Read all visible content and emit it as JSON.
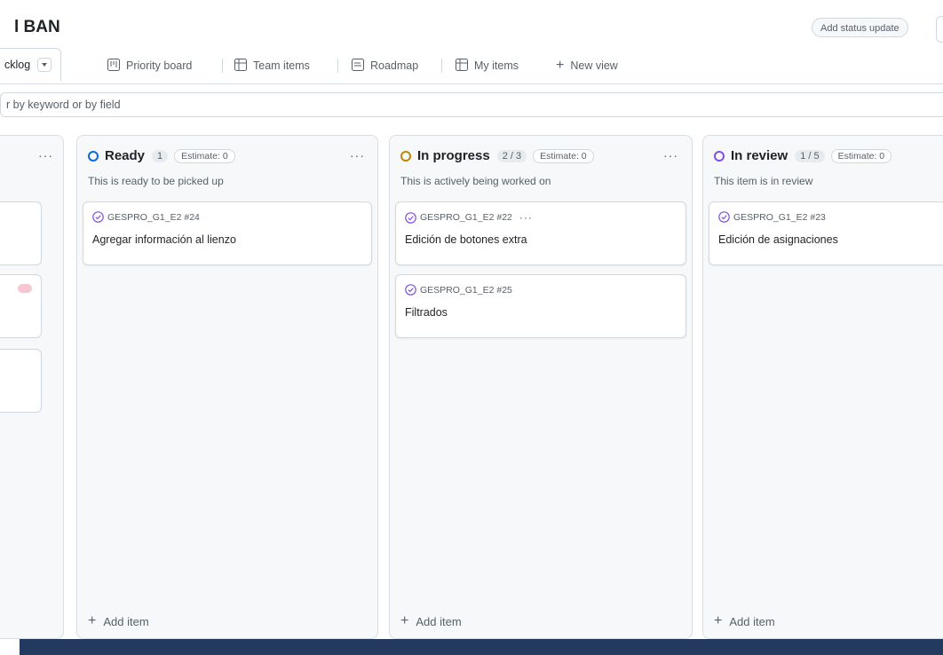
{
  "header": {
    "title": "l BAN",
    "status_button": "Add status update"
  },
  "tabs": [
    {
      "label": "cklog",
      "icon": "dropdown-icon"
    },
    {
      "label": "Priority board",
      "icon": "board-icon"
    },
    {
      "label": "Team items",
      "icon": "table-icon"
    },
    {
      "label": "Roadmap",
      "icon": "roadmap-icon"
    },
    {
      "label": "My items",
      "icon": "table-icon"
    },
    {
      "label": "New view",
      "icon": "plus-icon"
    }
  ],
  "filter": {
    "text": "r by keyword or by field"
  },
  "columns": [
    {
      "title": "Ready",
      "count": "1",
      "estimate": "Estimate: 0",
      "description": "This is ready to be picked up",
      "color": "#0969da",
      "cards": [
        {
          "ref": "GESPRO_G1_E2 #24",
          "title": "Agregar información al lienzo"
        }
      ],
      "add_label": "Add item"
    },
    {
      "title": "In progress",
      "count": "2 / 3",
      "estimate": "Estimate: 0",
      "description": "This is actively being worked on",
      "color": "#bf8700",
      "cards": [
        {
          "ref": "GESPRO_G1_E2 #22",
          "title": "Edición de botones extra",
          "menu": "···"
        },
        {
          "ref": "GESPRO_G1_E2 #25",
          "title": "Filtrados"
        }
      ],
      "add_label": "Add item"
    },
    {
      "title": "In review",
      "count": "1 / 5",
      "estimate": "Estimate: 0",
      "description": "This item is in review",
      "color": "#8250df",
      "cards": [
        {
          "ref": "GESPRO_G1_E2 #23",
          "title": "Edición de asignaciones"
        }
      ],
      "add_label": "Add item"
    }
  ],
  "column_menu": "···",
  "colors": {
    "ready": "#0969da",
    "in_progress": "#bf8700",
    "in_review": "#8250df",
    "card_check": "#8250df",
    "bottom_band": "#23395d"
  }
}
